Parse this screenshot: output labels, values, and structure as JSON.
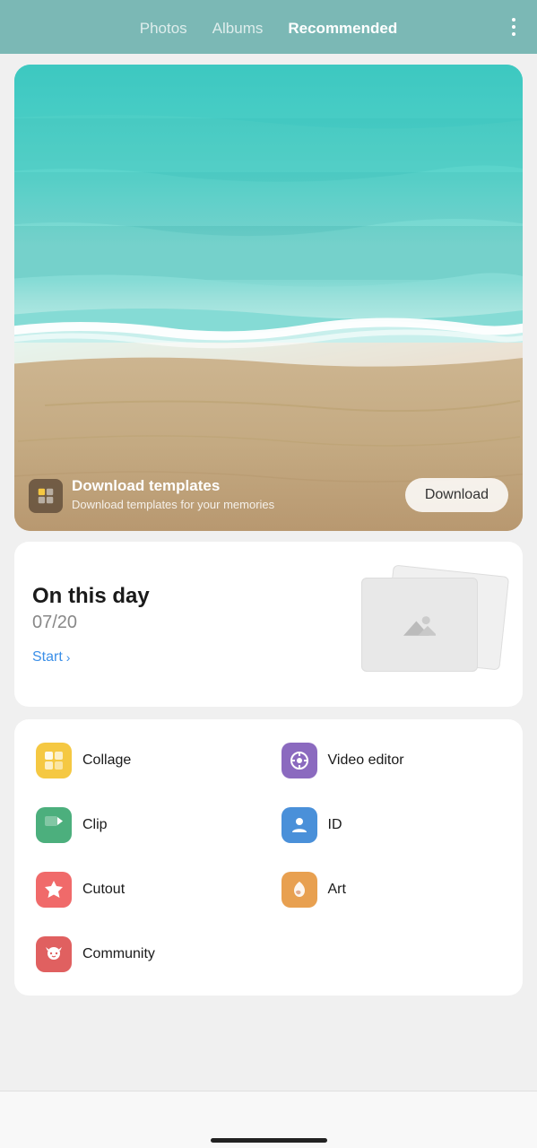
{
  "header": {
    "tabs": [
      {
        "label": "Photos",
        "active": false
      },
      {
        "label": "Albums",
        "active": false
      },
      {
        "label": "Recommended",
        "active": true
      }
    ],
    "more_icon": "more-vertical-icon"
  },
  "hero": {
    "icon_label": "download-templates-icon",
    "title": "Download templates",
    "subtitle": "Download templates for your memories",
    "download_button": "Download"
  },
  "on_this_day": {
    "title": "On this day",
    "date": "07/20",
    "start_label": "Start",
    "chevron": "›"
  },
  "features": [
    {
      "id": "collage",
      "label": "Collage",
      "icon_class": "icon-collage",
      "icon_symbol": "▦"
    },
    {
      "id": "video-editor",
      "label": "Video editor",
      "icon_class": "icon-video",
      "icon_symbol": "◎"
    },
    {
      "id": "clip",
      "label": "Clip",
      "icon_class": "icon-clip",
      "icon_symbol": "▶"
    },
    {
      "id": "id",
      "label": "ID",
      "icon_class": "icon-id",
      "icon_symbol": "👤"
    },
    {
      "id": "cutout",
      "label": "Cutout",
      "icon_class": "icon-cutout",
      "icon_symbol": "✦"
    },
    {
      "id": "art",
      "label": "Art",
      "icon_class": "icon-art",
      "icon_symbol": "🌸"
    },
    {
      "id": "community",
      "label": "Community",
      "icon_class": "icon-community",
      "icon_symbol": "🐾"
    }
  ],
  "bottom_nav": {
    "indicator_label": "home-indicator"
  }
}
